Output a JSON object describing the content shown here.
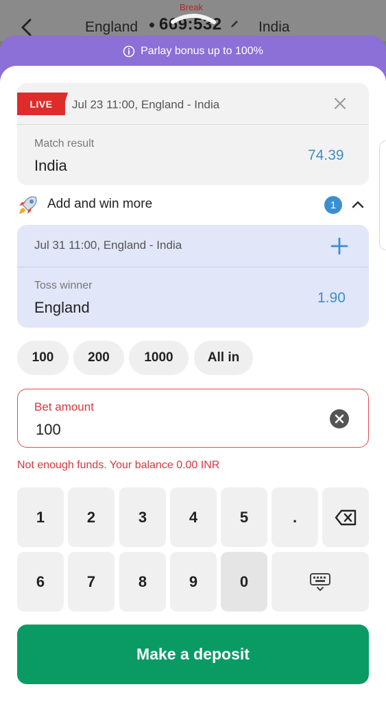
{
  "match_header": {
    "team_left": "England",
    "team_right": "India",
    "score": "669:532",
    "status": "Break"
  },
  "banner": {
    "text": "Parlay bonus up to 100%"
  },
  "bet1": {
    "live_label": "LIVE",
    "event": "Jul 23 11:00, England - India",
    "market": "Match result",
    "selection": "India",
    "odds": "74.39"
  },
  "add_more": {
    "label": "Add and win more",
    "count": "1"
  },
  "bet2": {
    "event": "Jul 31 11:00, England - India",
    "market": "Toss winner",
    "selection": "England",
    "odds": "1.90"
  },
  "quick_stakes": [
    "100",
    "200",
    "1000",
    "All in"
  ],
  "bet_amount": {
    "label": "Bet amount",
    "value": "100",
    "error": "Not enough funds. Your balance 0.00 INR"
  },
  "keypad": {
    "row1": [
      "1",
      "2",
      "3",
      "4",
      "5",
      "."
    ],
    "row2": [
      "6",
      "7",
      "8",
      "9",
      "0"
    ]
  },
  "deposit_button": {
    "label": "Make a deposit"
  },
  "colors": {
    "purple": "#8c6fd7",
    "live_red": "#e02b2b",
    "odds_blue": "#3e8ec8",
    "error_red": "#d9363e",
    "deposit_green": "#0a9b65"
  }
}
